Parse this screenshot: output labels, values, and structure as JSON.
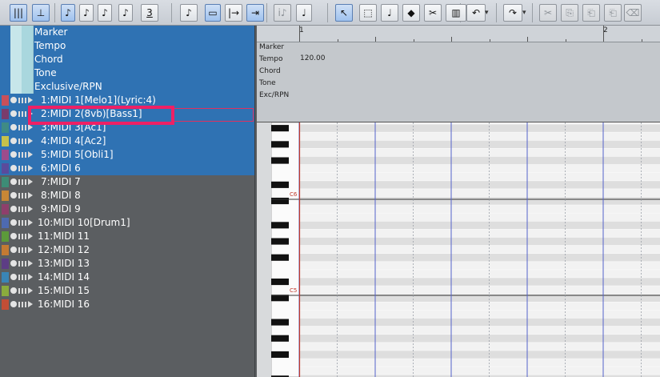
{
  "toolbar": {
    "buttons": [
      {
        "name": "grid-view-icon",
        "glyph": "|||",
        "on": true
      },
      {
        "name": "snap-icon",
        "glyph": "⊥",
        "on": true
      },
      {
        "name": "eighth-note-icon",
        "glyph": "♪",
        "on": true
      },
      {
        "name": "sixteenth-note-icon",
        "glyph": "♪",
        "on": false
      },
      {
        "name": "thirty-second-note-icon",
        "glyph": "♪",
        "on": false
      },
      {
        "name": "sixty-fourth-note-icon",
        "glyph": "♪",
        "on": false
      },
      {
        "name": "triplet-icon",
        "glyph": "3",
        "on": false
      },
      {
        "name": "magic-note-icon",
        "glyph": "♪",
        "on": false
      },
      {
        "name": "keyboard-display-icon",
        "glyph": "▭",
        "on": true
      },
      {
        "name": "arrow-to-bar-icon",
        "glyph": "|→",
        "on": false
      },
      {
        "name": "cursor-split-icon",
        "glyph": "⇥",
        "on": true
      },
      {
        "name": "info-icon",
        "glyph": "i♪",
        "on": false,
        "disabled": true
      },
      {
        "name": "score-icon",
        "glyph": "♩",
        "on": false
      },
      {
        "name": "pointer-icon",
        "glyph": "↖",
        "on": true
      },
      {
        "name": "range-select-icon",
        "glyph": "⬚",
        "on": false
      },
      {
        "name": "pencil-note-icon",
        "glyph": "♩",
        "on": false
      },
      {
        "name": "eraser-tool-icon",
        "glyph": "◆",
        "on": false
      },
      {
        "name": "scissors-icon",
        "glyph": "✂",
        "on": false
      },
      {
        "name": "piano-input-icon",
        "glyph": "▥",
        "on": false
      },
      {
        "name": "undo-icon",
        "glyph": "↶",
        "on": false
      },
      {
        "name": "redo-icon",
        "glyph": "↷",
        "on": false
      },
      {
        "name": "cut-icon",
        "glyph": "✂",
        "on": false,
        "disabled": true
      },
      {
        "name": "copy-icon",
        "glyph": "⎘",
        "on": false,
        "disabled": true
      },
      {
        "name": "paste-icon",
        "glyph": "⎗",
        "on": false,
        "disabled": true
      },
      {
        "name": "paste-special-icon",
        "glyph": "⎗",
        "on": false,
        "disabled": true
      },
      {
        "name": "delete-icon",
        "glyph": "⌫",
        "on": false,
        "disabled": true
      }
    ]
  },
  "conductor_tracks": [
    "Marker",
    "Tempo",
    "Chord",
    "Tone",
    "Exclusive/RPN"
  ],
  "tracks": [
    {
      "label": "1:MIDI 1[Melo1](Lyric:4)",
      "color": "#c9505a",
      "selected": true
    },
    {
      "label": "2:MIDI 2(8vb)[Bass1]",
      "color": "#7a3c6c",
      "selected": true
    },
    {
      "label": "3:MIDI 3[Ac1]",
      "color": "#3f8b85",
      "selected": true
    },
    {
      "label": "4:MIDI 4[Ac2]",
      "color": "#c6c14b",
      "selected": true
    },
    {
      "label": "5:MIDI 5[Obli1]",
      "color": "#9c4c8c",
      "selected": true
    },
    {
      "label": "6:MIDI 6",
      "color": "#5a4b9c",
      "selected": true
    },
    {
      "label": "7:MIDI 7",
      "color": "#3d8c76",
      "selected": false
    },
    {
      "label": "8:MIDI 8",
      "color": "#c78736",
      "selected": false
    },
    {
      "label": "9:MIDI 9",
      "color": "#8e3f6b",
      "selected": false
    },
    {
      "label": "10:MIDI 10[Drum1]",
      "color": "#4e6ab0",
      "selected": false
    },
    {
      "label": "11:MIDI 11",
      "color": "#5c9a3a",
      "selected": false
    },
    {
      "label": "12:MIDI 12",
      "color": "#c47a33",
      "selected": false
    },
    {
      "label": "13:MIDI 13",
      "color": "#5d3d85",
      "selected": false
    },
    {
      "label": "14:MIDI 14",
      "color": "#3a85b6",
      "selected": false
    },
    {
      "label": "15:MIDI 15",
      "color": "#8aab3d",
      "selected": false
    },
    {
      "label": "16:MIDI 16",
      "color": "#c24e36",
      "selected": false
    }
  ],
  "ruler": {
    "bar1": "1",
    "bar2": "2"
  },
  "conductor_lanes": [
    "Marker",
    "Tempo",
    "Chord",
    "Tone",
    "Exc/RPN"
  ],
  "tempo_value": "120.00",
  "piano": {
    "labels": [
      "C6",
      "C5"
    ]
  }
}
